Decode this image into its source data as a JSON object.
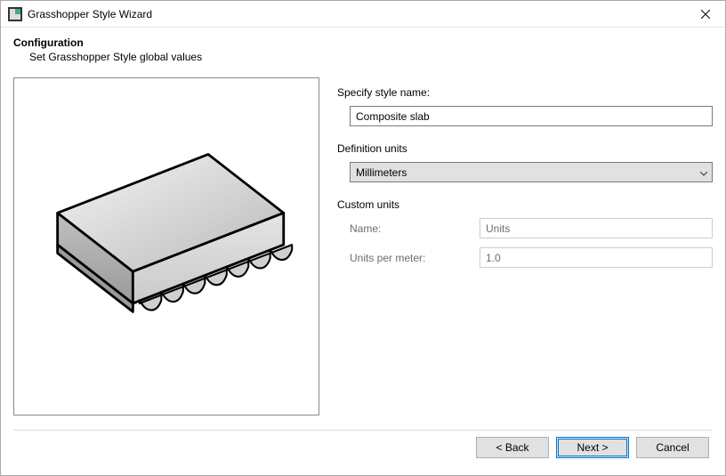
{
  "window": {
    "title": "Grasshopper Style Wizard"
  },
  "header": {
    "title": "Configuration",
    "subtitle": "Set Grasshopper Style global values"
  },
  "form": {
    "style_name_label": "Specify style name:",
    "style_name_value": "Composite slab",
    "definition_units_label": "Definition units",
    "definition_units_value": "Millimeters",
    "custom_units_label": "Custom units",
    "custom_name_label": "Name:",
    "custom_name_value": "Units",
    "custom_upm_label": "Units per meter:",
    "custom_upm_value": "1.0"
  },
  "buttons": {
    "back": "< Back",
    "next": "Next >",
    "cancel": "Cancel"
  }
}
